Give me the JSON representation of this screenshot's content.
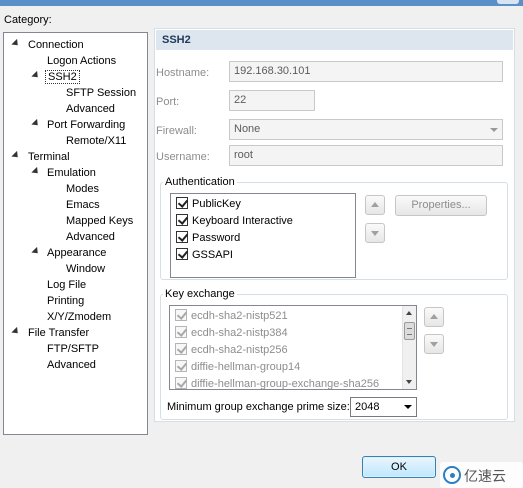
{
  "category_label": "Category:",
  "tree": [
    {
      "label": "Connection"
    },
    {
      "label": "Logon Actions"
    },
    {
      "label": "SSH2"
    },
    {
      "label": "SFTP Session"
    },
    {
      "label": "Advanced"
    },
    {
      "label": "Port Forwarding"
    },
    {
      "label": "Remote/X11"
    },
    {
      "label": "Terminal"
    },
    {
      "label": "Emulation"
    },
    {
      "label": "Modes"
    },
    {
      "label": "Emacs"
    },
    {
      "label": "Mapped Keys"
    },
    {
      "label": "Advanced"
    },
    {
      "label": "Appearance"
    },
    {
      "label": "Window"
    },
    {
      "label": "Log File"
    },
    {
      "label": "Printing"
    },
    {
      "label": "X/Y/Zmodem"
    },
    {
      "label": "File Transfer"
    },
    {
      "label": "FTP/SFTP"
    },
    {
      "label": "Advanced"
    }
  ],
  "panel_title": "SSH2",
  "fields": {
    "hostname": {
      "label": "Hostname:",
      "value": "192.168.30.101"
    },
    "port": {
      "label": "Port:",
      "value": "22"
    },
    "firewall": {
      "label": "Firewall:",
      "value": "None"
    },
    "username": {
      "label": "Username:",
      "value": "root"
    }
  },
  "authentication": {
    "title": "Authentication",
    "items": [
      {
        "label": "PublicKey",
        "checked": true
      },
      {
        "label": "Keyboard Interactive",
        "checked": true
      },
      {
        "label": "Password",
        "checked": true
      },
      {
        "label": "GSSAPI",
        "checked": true
      }
    ],
    "properties_label": "Properties..."
  },
  "key_exchange": {
    "title": "Key exchange",
    "items": [
      {
        "label": "ecdh-sha2-nistp521",
        "checked": true
      },
      {
        "label": "ecdh-sha2-nistp384",
        "checked": true
      },
      {
        "label": "ecdh-sha2-nistp256",
        "checked": true
      },
      {
        "label": "diffie-hellman-group14",
        "checked": true
      },
      {
        "label": "diffie-hellman-group-exchange-sha256",
        "checked": true
      }
    ],
    "min_group_label": "Minimum group exchange prime size:",
    "min_group_value": "2048"
  },
  "ok_label": "OK",
  "watermark": "亿速云"
}
